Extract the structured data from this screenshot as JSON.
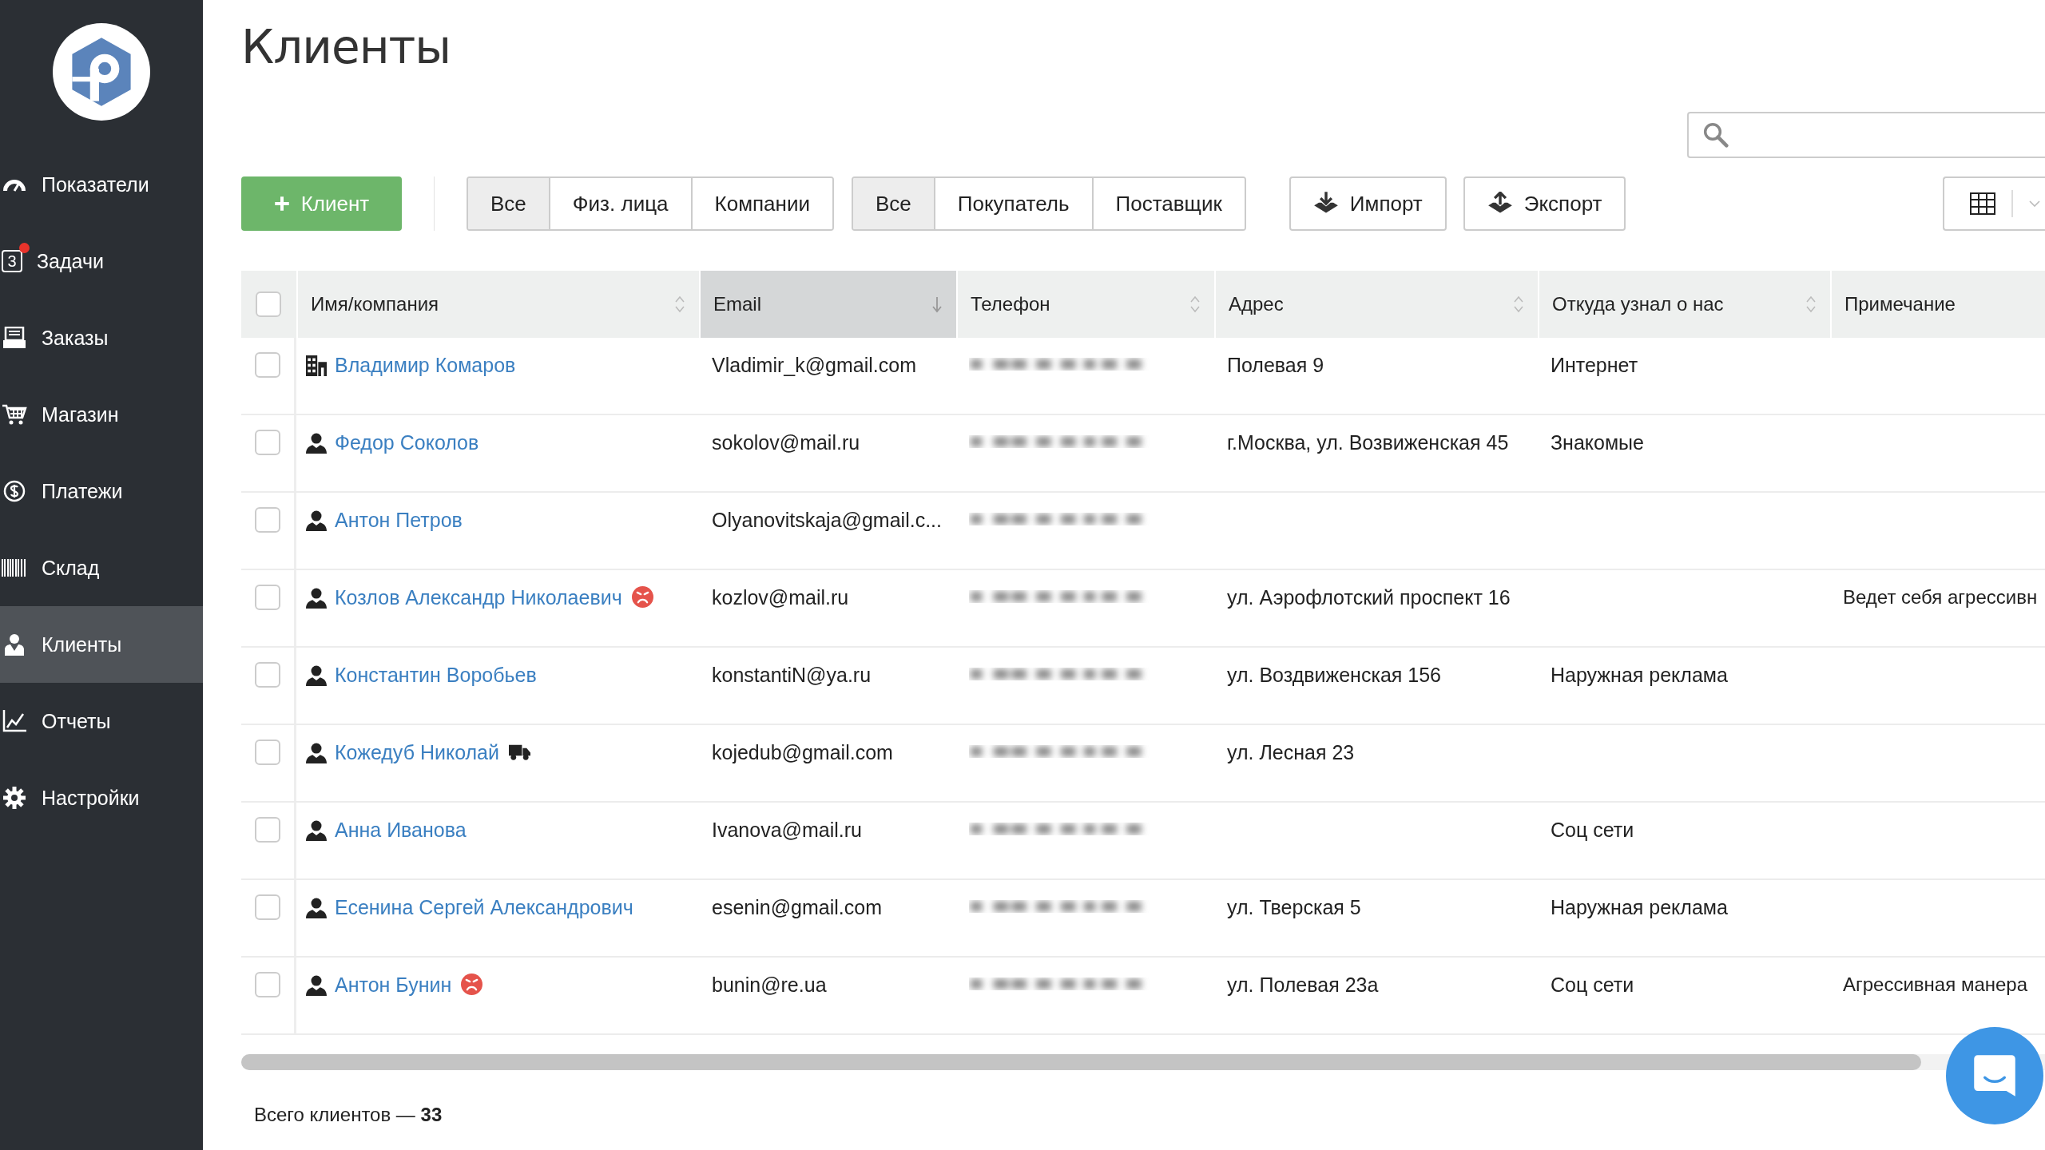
{
  "sidebar": {
    "items": [
      {
        "label": "Показатели",
        "selected": false
      },
      {
        "label": "Задачи",
        "icon_text": "3",
        "notification": true,
        "selected": false
      },
      {
        "label": "Заказы",
        "selected": false
      },
      {
        "label": "Магазин",
        "selected": false
      },
      {
        "label": "Платежи",
        "selected": false
      },
      {
        "label": "Склад",
        "selected": false
      },
      {
        "label": "Клиенты",
        "selected": true
      },
      {
        "label": "Отчеты",
        "selected": false
      },
      {
        "label": "Настройки",
        "selected": false
      }
    ]
  },
  "page_title": "Клиенты",
  "toolbar": {
    "add_button": "Клиент",
    "type_filter": [
      {
        "label": "Все",
        "selected": true
      },
      {
        "label": "Физ. лица",
        "selected": false
      },
      {
        "label": "Компании",
        "selected": false
      }
    ],
    "role_filter": [
      {
        "label": "Все",
        "selected": true
      },
      {
        "label": "Покупатель",
        "selected": false
      },
      {
        "label": "Поставщик",
        "selected": false
      }
    ],
    "import_button": "Импорт",
    "export_button": "Экспорт"
  },
  "table": {
    "select_all_checked": false,
    "columns": [
      {
        "label": "Имя/компания",
        "kind": "sortable",
        "selected": false
      },
      {
        "label": "Email",
        "kind": "sortable",
        "selected": true
      },
      {
        "label": "Телефон",
        "kind": "sortable",
        "selected": false
      },
      {
        "label": "Адрес",
        "kind": "sortable",
        "selected": false
      },
      {
        "label": "Откуда узнал о нас",
        "kind": "sortable",
        "selected": false
      },
      {
        "label": "Примечание",
        "kind": "plain",
        "selected": false
      }
    ],
    "rows": [
      {
        "checked": false,
        "kind": "company",
        "aggressive": false,
        "delivery": false,
        "name": "Владимир Комаров",
        "email": "Vladimir_k@gmail.com",
        "address": "Полевая 9",
        "source": "Интернет"
      },
      {
        "checked": false,
        "kind": "person",
        "aggressive": false,
        "delivery": false,
        "name": "Федор Соколов",
        "email": "sokolov@mail.ru",
        "address": "г.Москва, ул. Возвиженская 45",
        "source": "Знакомые"
      },
      {
        "checked": false,
        "kind": "person",
        "aggressive": false,
        "delivery": false,
        "name": "Антон Петров",
        "email": "Olyanovitskaja@gmail.c..."
      },
      {
        "checked": false,
        "kind": "person",
        "aggressive": true,
        "delivery": false,
        "name": "Козлов Александр Николаевич",
        "email": "kozlov@mail.ru",
        "address": "ул. Аэрофлотский проспект 16",
        "note": "Ведет себя агрессивн"
      },
      {
        "checked": false,
        "kind": "person",
        "aggressive": false,
        "delivery": false,
        "name": "Константин Воробьев",
        "email": "konstantiN@ya.ru",
        "address": "ул. Воздвиженская 156",
        "source": "Наружная реклама"
      },
      {
        "checked": false,
        "kind": "person",
        "aggressive": false,
        "delivery": true,
        "name": "Кожедуб Николай",
        "email": "kojedub@gmail.com",
        "address": "ул. Лесная 23"
      },
      {
        "checked": false,
        "kind": "person",
        "aggressive": false,
        "delivery": false,
        "name": "Анна Иванова",
        "email": "Ivanova@mail.ru",
        "source": "Соц сети"
      },
      {
        "checked": false,
        "kind": "person",
        "aggressive": false,
        "delivery": false,
        "name": "Есенина Сергей Александрович",
        "email": "esenin@gmail.com",
        "address": "ул. Тверская 5",
        "source": "Наружная реклама"
      },
      {
        "checked": false,
        "kind": "person",
        "aggressive": true,
        "delivery": false,
        "name": "Антон Бунин",
        "email": "bunin@re.ua",
        "address": "ул. Полевая 23а",
        "source": "Соц сети",
        "note": "Агрессивная манера"
      }
    ]
  },
  "footer": {
    "total": "Всего клиентов — **33**"
  }
}
